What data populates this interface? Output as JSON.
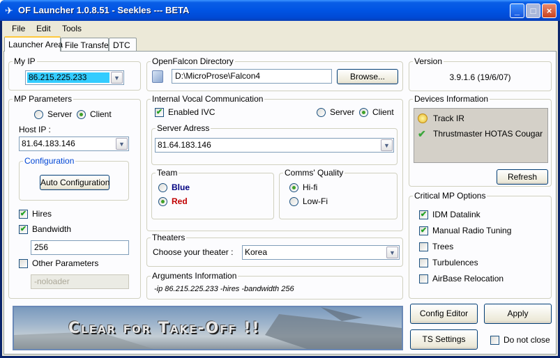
{
  "window": {
    "title": "OF Launcher 1.0.8.51 - Seekles --- BETA",
    "min": "_",
    "max": "□",
    "close": "×"
  },
  "menu": [
    "File",
    "Edit",
    "Tools"
  ],
  "tabs": [
    "Launcher Area",
    "File Transfer",
    "DTC"
  ],
  "my_ip": {
    "label": "My IP",
    "value": "86.215.225.233"
  },
  "mp_parameters": {
    "label": "MP Parameters",
    "server": "Server",
    "client": "Client",
    "host_ip_label": "Host IP :",
    "host_ip": "81.64.183.146",
    "configuration": "Configuration",
    "auto_config": "Auto Configuration",
    "hires": "Hires",
    "bandwidth": "Bandwidth",
    "bandwidth_value": "256",
    "other_params": "Other Parameters",
    "other_value": "-noloader"
  },
  "of_dir": {
    "label": "OpenFalcon Directory",
    "path": "D:\\MicroProse\\Falcon4",
    "browse": "Browse..."
  },
  "ivc": {
    "label": "Internal Vocal Communication",
    "enabled": "Enabled IVC",
    "server": "Server",
    "client": "Client",
    "server_address_label": "Server Adress",
    "server_address": "81.64.183.146",
    "team_label": "Team",
    "blue": "Blue",
    "red": "Red",
    "quality_label": "Comms' Quality",
    "hifi": "Hi-fi",
    "lofi": "Low-Fi"
  },
  "theaters": {
    "label": "Theaters",
    "choose": "Choose your theater :",
    "value": "Korea"
  },
  "arguments": {
    "label": "Arguments Information",
    "value": "-ip 86.215.225.233 -hires -bandwidth 256"
  },
  "version": {
    "label": "Version",
    "value": "3.9.1.6 (19/6/07)"
  },
  "devices": {
    "label": "Devices Information",
    "items": [
      "Track IR",
      "Thrustmaster HOTAS Cougar"
    ],
    "refresh": "Refresh"
  },
  "critical": {
    "label": "Critical MP Options",
    "items": [
      "IDM Datalink",
      "Manual Radio Tuning",
      "Trees",
      "Turbulences",
      "AirBase Relocation"
    ]
  },
  "banner": {
    "text": "Clear for Take-Off !!"
  },
  "buttons": {
    "config_editor": "Config Editor",
    "apply": "Apply",
    "ts_settings": "TS Settings",
    "do_not_close": "Do not close"
  },
  "colors": {
    "titlebar": "#0054e3",
    "highlight": "#33ccff",
    "blue_team": "#000080",
    "red_team": "#c00000"
  }
}
